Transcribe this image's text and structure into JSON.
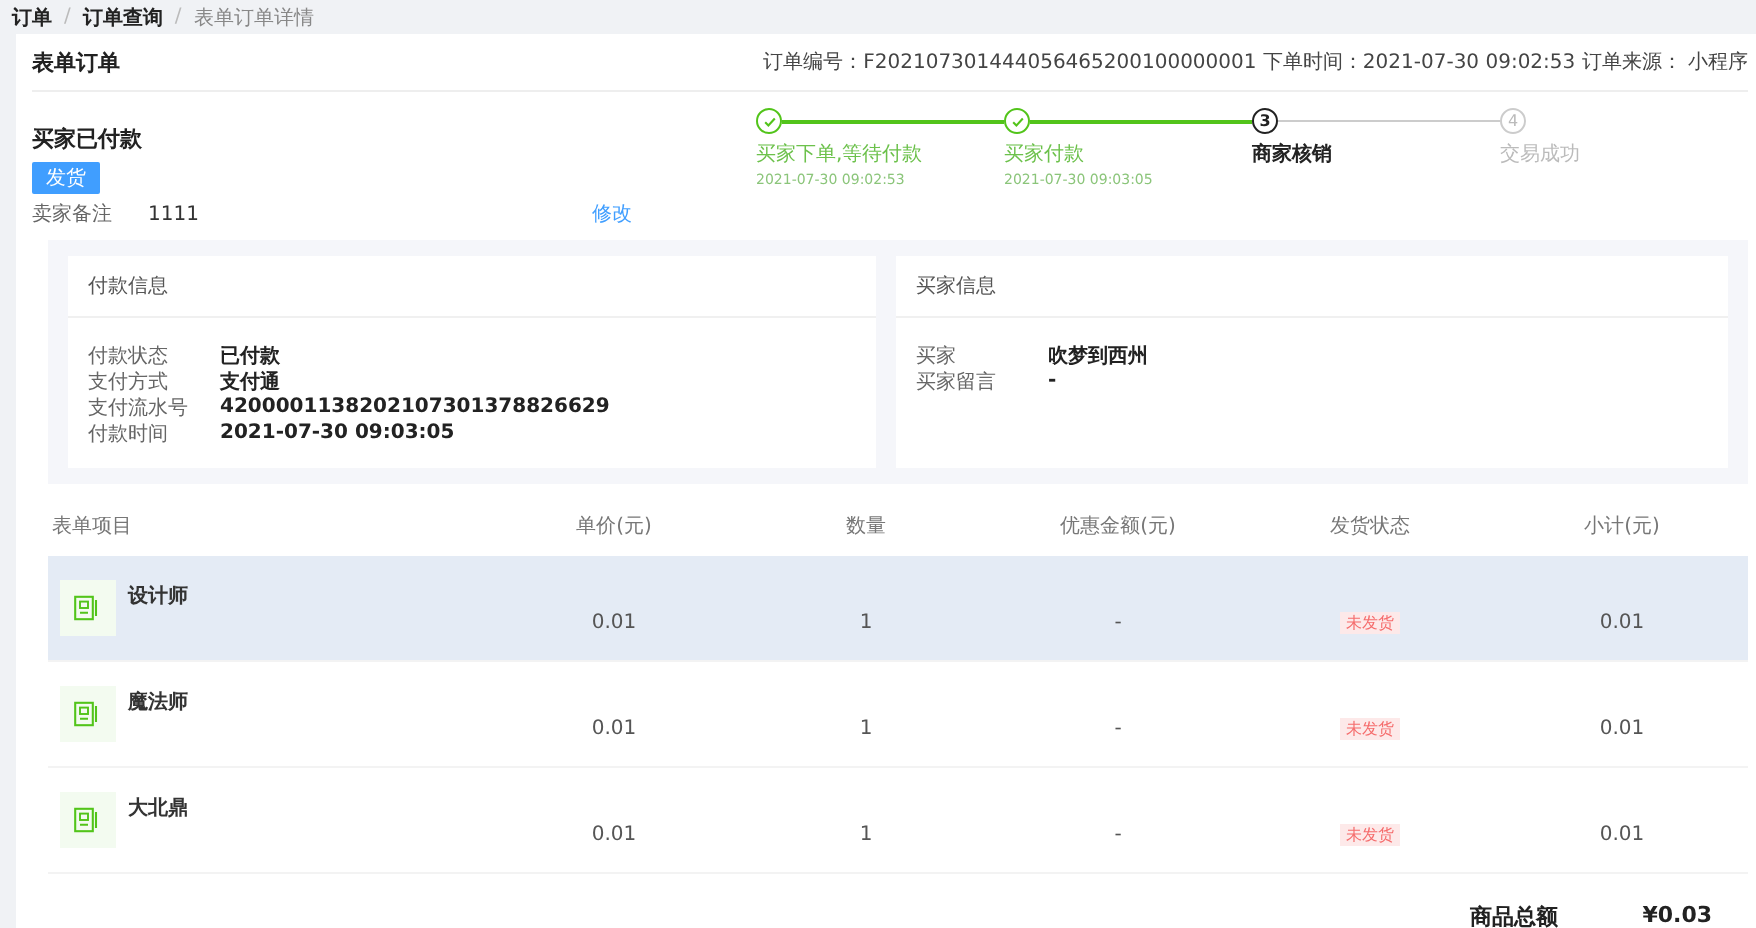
{
  "breadcrumb": [
    {
      "label": "订单",
      "current": false
    },
    {
      "label": "订单查询",
      "current": false
    },
    {
      "label": "表单订单详情",
      "current": true
    }
  ],
  "breadcrumb_separator": "/",
  "page_title": "表单订单",
  "order_meta": "订单编号：F202107301444056465200100000001 下单时间：2021-07-30 09:02:53 订单来源： 小程序",
  "order_status": {
    "title": "买家已付款",
    "ship_button": "发货",
    "note_label": "卖家备注",
    "note_value": "1111",
    "edit_link": "修改"
  },
  "steps": [
    {
      "label": "买家下单,等待付款",
      "time": "2021-07-30 09:02:53",
      "completed": true,
      "active": false
    },
    {
      "label": "买家付款",
      "time": "2021-07-30 09:03:05",
      "completed": true,
      "active": false
    },
    {
      "number": "3",
      "label": "商家核销",
      "completed": false,
      "active": true
    },
    {
      "number": "4",
      "label": "交易成功",
      "completed": false,
      "active": false
    }
  ],
  "payment_info": {
    "title": "付款信息",
    "fields": [
      {
        "label": "付款状态",
        "value": "已付款"
      },
      {
        "label": "支付方式",
        "value": "支付通"
      },
      {
        "label": "支付流水号",
        "value": "4200001138202107301378826629"
      },
      {
        "label": "付款时间",
        "value": "2021-07-30 09:03:05"
      }
    ]
  },
  "buyer_info": {
    "title": "买家信息",
    "fields": [
      {
        "label": "买家",
        "value": "吹梦到西州"
      },
      {
        "label": "买家留言",
        "value": "-"
      }
    ]
  },
  "table": {
    "columns": [
      "表单项目",
      "单价(元)",
      "数量",
      "优惠金额(元)",
      "发货状态",
      "小计(元)"
    ],
    "rows": [
      {
        "name": "设计师",
        "price": "0.01",
        "qty": "1",
        "discount": "-",
        "ship_status": "未发货",
        "subtotal": "0.01",
        "hovered": true
      },
      {
        "name": "魔法师",
        "price": "0.01",
        "qty": "1",
        "discount": "-",
        "ship_status": "未发货",
        "subtotal": "0.01",
        "hovered": false
      },
      {
        "name": "大北鼎",
        "price": "0.01",
        "qty": "1",
        "discount": "-",
        "ship_status": "未发货",
        "subtotal": "0.01",
        "hovered": false
      }
    ]
  },
  "total": {
    "label": "商品总额",
    "value": "¥0.03"
  }
}
